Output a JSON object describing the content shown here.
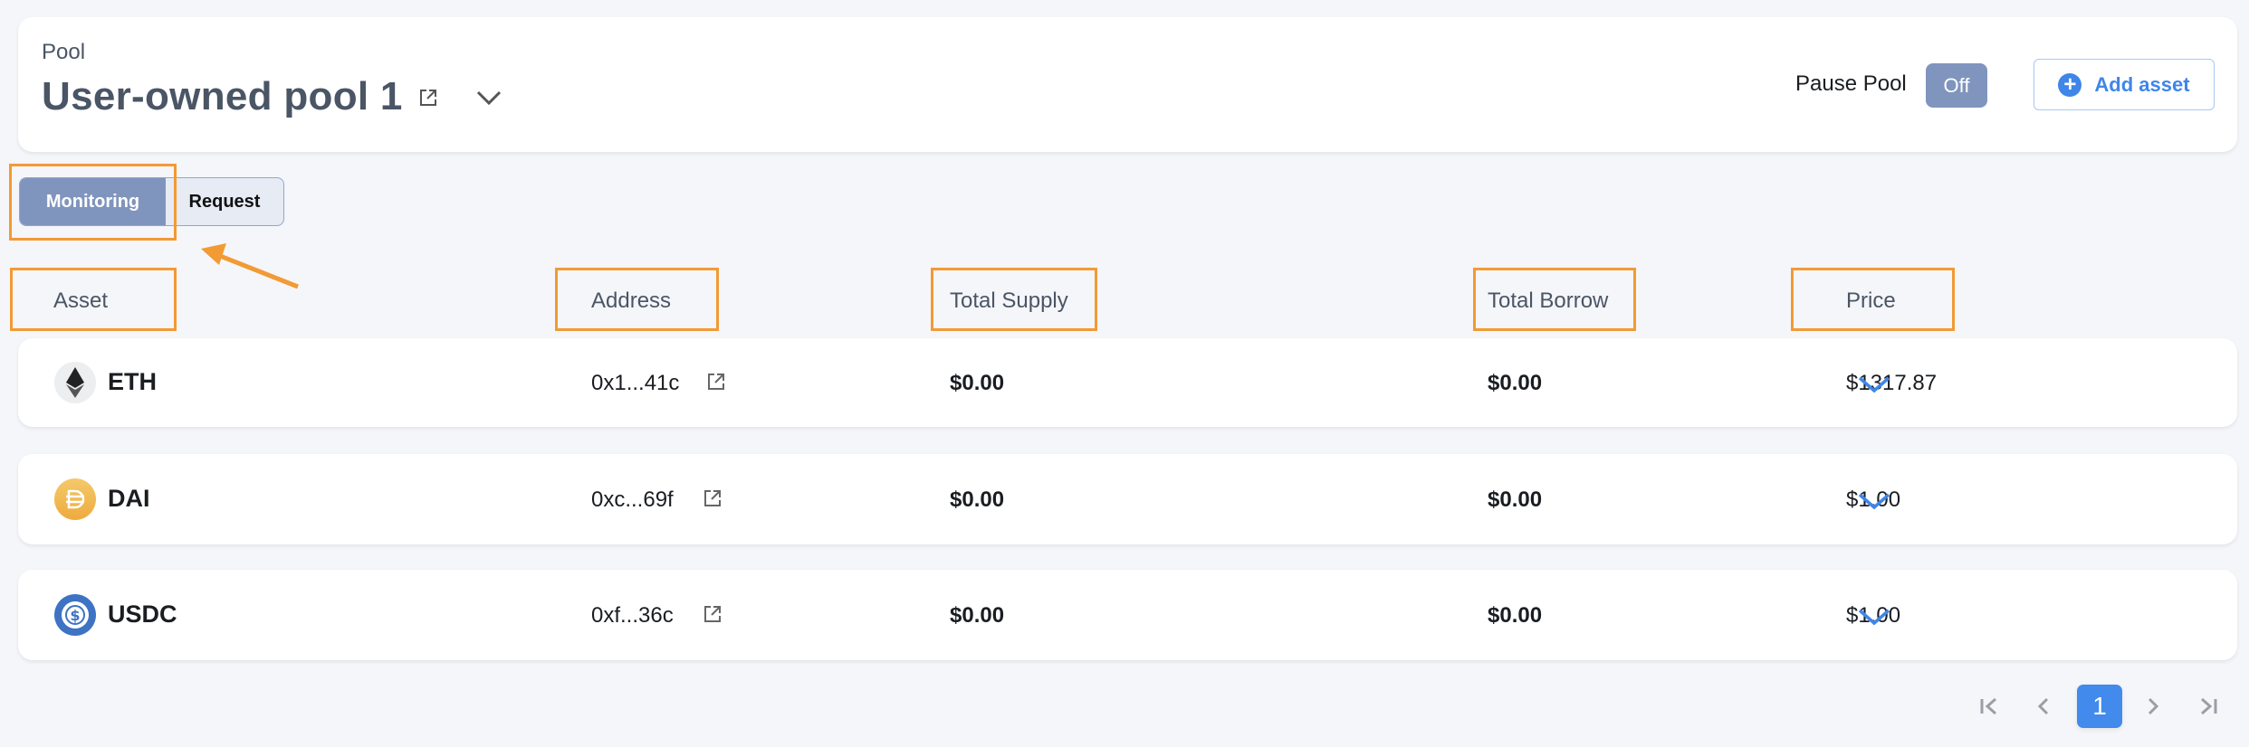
{
  "header": {
    "section_label": "Pool",
    "title": "User-owned pool 1",
    "pause_label": "Pause Pool",
    "pause_value": "Off",
    "add_asset_label": "Add asset"
  },
  "tabs": [
    {
      "label": "Monitoring",
      "active": true
    },
    {
      "label": "Request",
      "active": false
    }
  ],
  "table": {
    "columns": [
      "Asset",
      "Address",
      "Total Supply",
      "Total Borrow",
      "Price"
    ],
    "rows": [
      {
        "symbol": "ETH",
        "icon": "ethereum-icon",
        "address": "0x1...41c",
        "total_supply": "$0.00",
        "total_borrow": "$0.00",
        "price": "$1317.87"
      },
      {
        "symbol": "DAI",
        "icon": "dai-icon",
        "address": "0xc...69f",
        "total_supply": "$0.00",
        "total_borrow": "$0.00",
        "price": "$1.00"
      },
      {
        "symbol": "USDC",
        "icon": "usdc-icon",
        "address": "0xf...36c",
        "total_supply": "$0.00",
        "total_borrow": "$0.00",
        "price": "$1.00"
      }
    ]
  },
  "pagination": {
    "current_page": "1"
  },
  "colors": {
    "accent": "#428aeb",
    "tab_active": "#8095bd",
    "highlight": "#f29a34"
  }
}
